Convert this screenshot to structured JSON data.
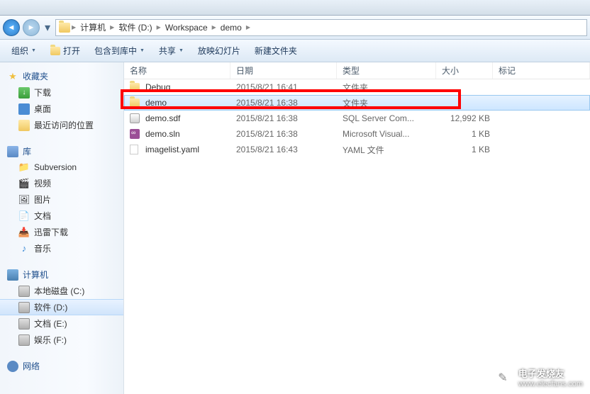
{
  "breadcrumb": {
    "computer": "计算机",
    "drive": "软件 (D:)",
    "folder1": "Workspace",
    "folder2": "demo"
  },
  "toolbar": {
    "organize": "组织",
    "open": "打开",
    "include_lib": "包含到库中",
    "share": "共享",
    "slideshow": "放映幻灯片",
    "new_folder": "新建文件夹"
  },
  "columns": {
    "name": "名称",
    "date": "日期",
    "type": "类型",
    "size": "大小",
    "tag": "标记"
  },
  "sidebar": {
    "favorites": "收藏夹",
    "downloads": "下载",
    "desktop": "桌面",
    "recent": "最近访问的位置",
    "libraries": "库",
    "subversion": "Subversion",
    "videos": "视频",
    "pictures": "图片",
    "documents": "文档",
    "xunlei": "迅雷下载",
    "music": "音乐",
    "computer": "计算机",
    "drive_c": "本地磁盘 (C:)",
    "drive_d": "软件 (D:)",
    "drive_e": "文档 (E:)",
    "drive_f": "娱乐 (F:)",
    "network": "网络"
  },
  "files": [
    {
      "name": "Debug",
      "date": "2015/8/21 16:41",
      "type": "文件夹",
      "size": "",
      "icon": "folder"
    },
    {
      "name": "demo",
      "date": "2015/8/21 16:38",
      "type": "文件夹",
      "size": "",
      "icon": "folder",
      "selected": true
    },
    {
      "name": "demo.sdf",
      "date": "2015/8/21 16:38",
      "type": "SQL Server Com...",
      "size": "12,992 KB",
      "icon": "sdf"
    },
    {
      "name": "demo.sln",
      "date": "2015/8/21 16:38",
      "type": "Microsoft Visual...",
      "size": "1 KB",
      "icon": "sln"
    },
    {
      "name": "imagelist.yaml",
      "date": "2015/8/21 16:43",
      "type": "YAML 文件",
      "size": "1 KB",
      "icon": "yaml"
    }
  ],
  "watermark": {
    "name": "电子发烧友",
    "url": "www.elecfans.com"
  }
}
